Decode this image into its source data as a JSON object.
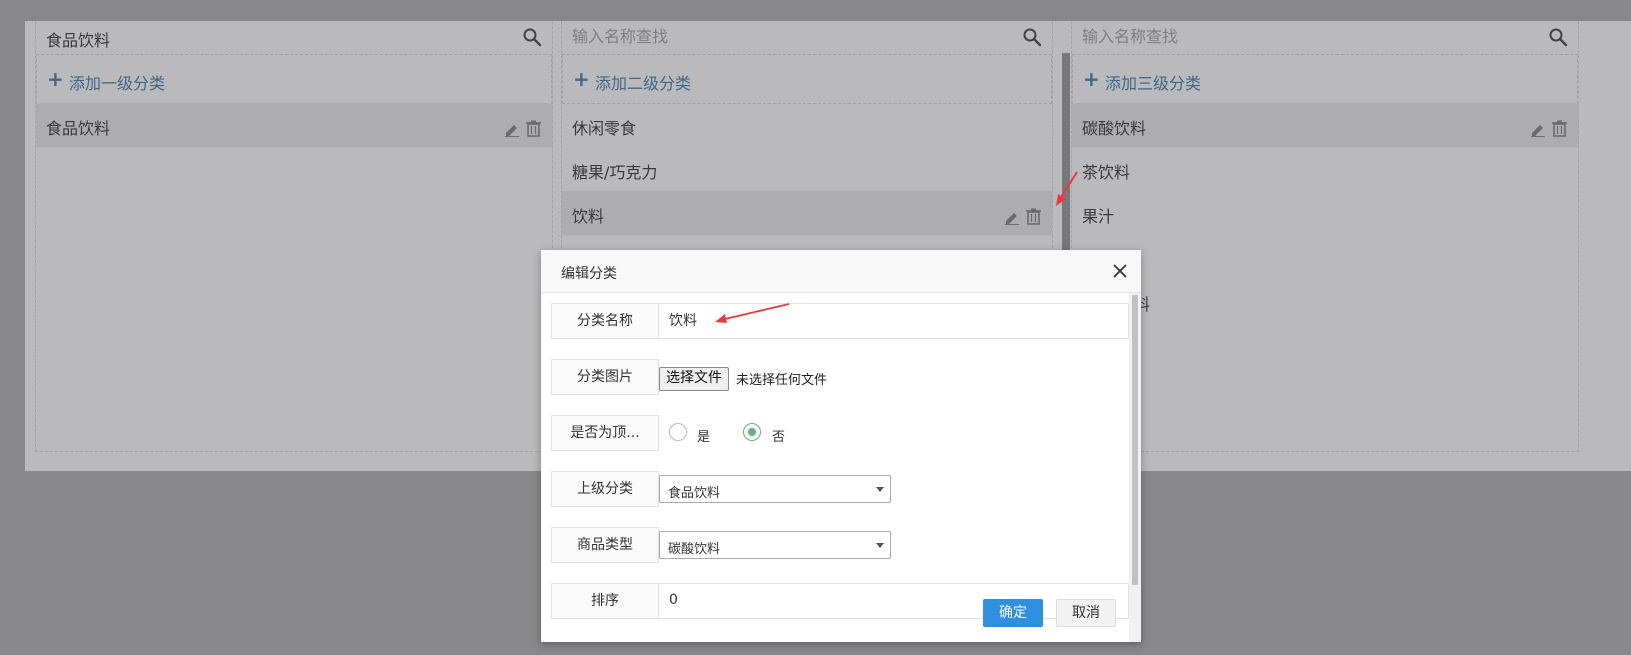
{
  "columns": [
    {
      "search_title": "食品饮料",
      "search_placeholder": "",
      "add_label": "添加一级分类",
      "items": [
        {
          "label": "食品饮料"
        }
      ]
    },
    {
      "search_title": "",
      "search_placeholder": "输入名称查找",
      "add_label": "添加二级分类",
      "items": [
        {
          "label": "休闲零食"
        },
        {
          "label": "糖果/巧克力"
        },
        {
          "label": "饮料"
        }
      ]
    },
    {
      "search_title": "",
      "search_placeholder": "输入名称查找",
      "add_label": "添加三级分类",
      "items": [
        {
          "label": "碳酸饮料"
        },
        {
          "label": "茶饮料"
        },
        {
          "label": "果汁"
        },
        {
          "label": "能饮料"
        }
      ]
    }
  ],
  "modal": {
    "title": "编辑分类",
    "fields": {
      "name_label": "分类名称",
      "name_value": "饮料",
      "image_label": "分类图片",
      "file_button": "选择文件",
      "file_note": "未选择任何文件",
      "top_label": "是否为顶...",
      "top_yes": "是",
      "top_no": "否",
      "top_selected": "否",
      "parent_label": "上级分类",
      "parent_value": "食品饮料",
      "type_label": "商品类型",
      "type_value": "碳酸饮料",
      "sort_label": "排序",
      "sort_value": "0"
    },
    "confirm_label": "确定",
    "cancel_label": "取消"
  },
  "colors": {
    "accent_blue": "#2e6ea6",
    "confirm_blue": "#2f8fe0",
    "radio_green": "#5fb878",
    "arrow_red": "#e83a3a"
  },
  "icons": [
    "search-icon",
    "plus-icon",
    "edit-icon",
    "trash-icon",
    "close-icon",
    "red-arrow-annotation"
  ]
}
